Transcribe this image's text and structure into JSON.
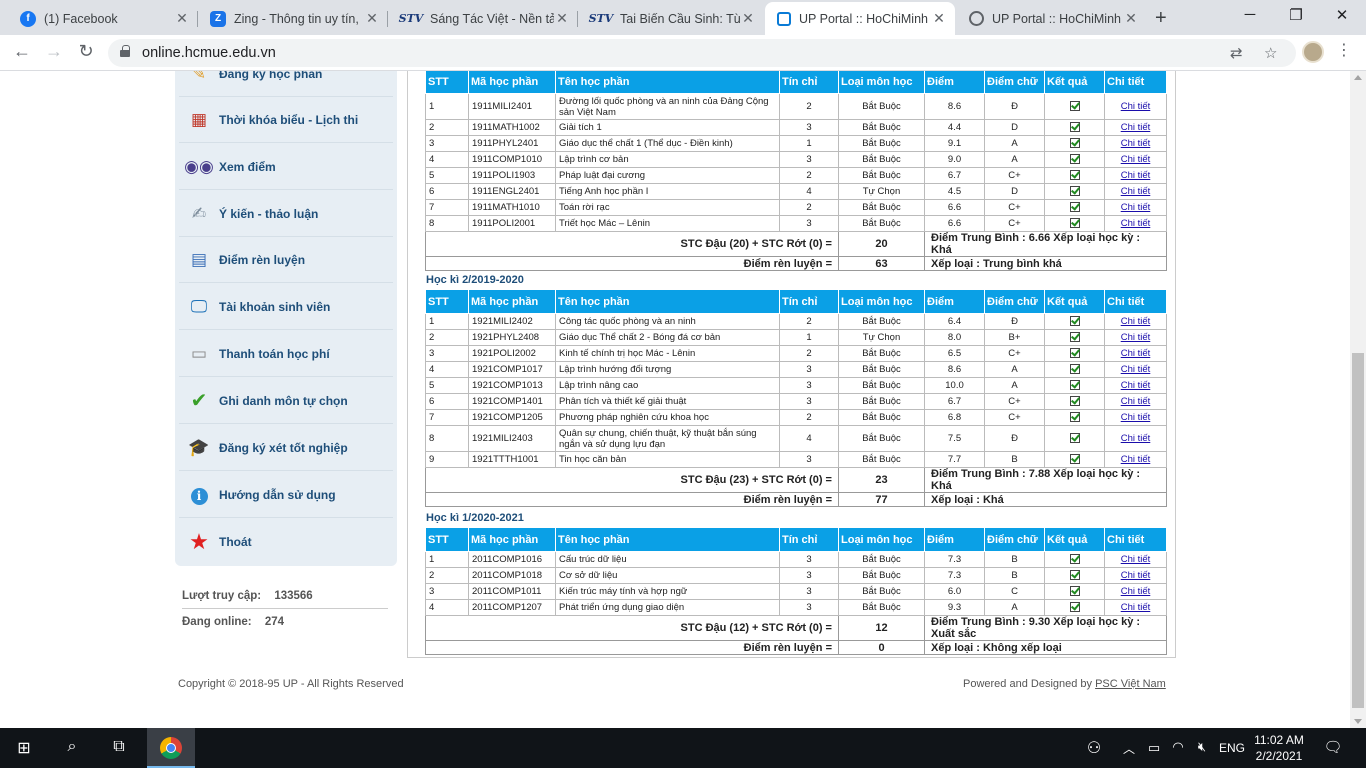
{
  "browser": {
    "tabs": [
      {
        "icon": "facebook-icon",
        "title": "(1) Facebook"
      },
      {
        "icon": "zing-icon",
        "title": "Zing - Thông tin uy tín,"
      },
      {
        "icon": "stv-icon",
        "title": "Sáng Tác Việt - Nền tản"
      },
      {
        "icon": "stv-icon",
        "title": "Tai Biến Cầu Sinh: Từ Đô"
      },
      {
        "icon": "up-portal-icon",
        "title": "UP Portal :: HoChiMinh"
      },
      {
        "icon": "globe-icon",
        "title": "UP Portal :: HoChiMinh"
      }
    ],
    "url": "online.hcmue.edu.vn"
  },
  "sidebar": {
    "items": [
      {
        "icon": "register-course-icon",
        "label": "Đăng ký học phần"
      },
      {
        "icon": "calendar-icon",
        "label": "Thời khóa biểu - Lịch thi"
      },
      {
        "icon": "binoculars-icon",
        "label": "Xem điểm"
      },
      {
        "icon": "feedback-icon",
        "label": "Ý kiến - thảo luận"
      },
      {
        "icon": "training-score-icon",
        "label": "Điểm rèn luyện"
      },
      {
        "icon": "monitor-icon",
        "label": "Tài khoản sinh viên"
      },
      {
        "icon": "payment-icon",
        "label": "Thanh toán học phí"
      },
      {
        "icon": "checkmark-icon",
        "label": "Ghi danh môn tự chọn"
      },
      {
        "icon": "graduation-cap-icon",
        "label": "Đăng ký xét tốt nghiệp"
      },
      {
        "icon": "info-icon",
        "label": "Hướng dẫn sử dụng"
      },
      {
        "icon": "star-icon",
        "label": "Thoát"
      }
    ],
    "visits_label": "Lượt truy cập:",
    "visits_value": "133566",
    "online_label": "Đang online:",
    "online_value": "274"
  },
  "table_headers": [
    "STT",
    "Mã học phần",
    "Tên học phần",
    "Tín chỉ",
    "Loại môn học",
    "Điểm",
    "Điểm chữ",
    "Kết quả",
    "Chi tiết"
  ],
  "detail_link": "Chi tiết",
  "semesters": [
    {
      "title": "",
      "rows": [
        [
          "1",
          "1911MILI2401",
          "Đường lối quốc phòng và an ninh của Đảng Cộng sản Việt Nam",
          "2",
          "Bắt Buộc",
          "8.6",
          "Đ"
        ],
        [
          "2",
          "1911MATH1002",
          "Giải tích 1",
          "3",
          "Bắt Buộc",
          "4.4",
          "D"
        ],
        [
          "3",
          "1911PHYL2401",
          "Giáo dục thể chất 1 (Thể dục - Điền kinh)",
          "1",
          "Bắt Buộc",
          "9.1",
          "A"
        ],
        [
          "4",
          "1911COMP1010",
          "Lập trình cơ bản",
          "3",
          "Bắt Buộc",
          "9.0",
          "A"
        ],
        [
          "5",
          "1911POLI1903",
          "Pháp luật đại cương",
          "2",
          "Bắt Buộc",
          "6.7",
          "C+"
        ],
        [
          "6",
          "1911ENGL2401",
          "Tiếng Anh học phần I",
          "4",
          "Tự Chọn",
          "4.5",
          "D"
        ],
        [
          "7",
          "1911MATH1010",
          "Toán rời rạc",
          "2",
          "Bắt Buộc",
          "6.6",
          "C+"
        ],
        [
          "8",
          "1911POLI2001",
          "Triết học Mác – Lênin",
          "3",
          "Bắt Buộc",
          "6.6",
          "C+"
        ]
      ],
      "summary1_label": "STC Đậu (20) + STC Rớt (0) =",
      "summary1_value": "20",
      "summary1_text": "Điểm Trung Bình : 6.66 Xếp loại học kỳ : Khá",
      "summary2_label": "Điểm rèn luyện =",
      "summary2_value": "63",
      "summary2_text": "Xếp loại : Trung bình khá"
    },
    {
      "title": "Học kì 2/2019-2020",
      "rows": [
        [
          "1",
          "1921MILI2402",
          "Công tác quốc phòng và an ninh",
          "2",
          "Bắt Buộc",
          "6.4",
          "Đ"
        ],
        [
          "2",
          "1921PHYL2408",
          "Giáo dục Thể chất 2 - Bóng đá cơ bản",
          "1",
          "Tự Chọn",
          "8.0",
          "B+"
        ],
        [
          "3",
          "1921POLI2002",
          "Kinh tế chính trị học Mác - Lênin",
          "2",
          "Bắt Buộc",
          "6.5",
          "C+"
        ],
        [
          "4",
          "1921COMP1017",
          "Lập trình hướng đối tượng",
          "3",
          "Bắt Buộc",
          "8.6",
          "A"
        ],
        [
          "5",
          "1921COMP1013",
          "Lập trình nâng cao",
          "3",
          "Bắt Buộc",
          "10.0",
          "A"
        ],
        [
          "6",
          "1921COMP1401",
          "Phân tích và thiết kế giải thuật",
          "3",
          "Bắt Buộc",
          "6.7",
          "C+"
        ],
        [
          "7",
          "1921COMP1205",
          "Phương pháp nghiên cứu khoa học",
          "2",
          "Bắt Buộc",
          "6.8",
          "C+"
        ],
        [
          "8",
          "1921MILI2403",
          "Quân sự chung, chiến thuật, kỹ thuật bắn súng ngắn và sử dụng lựu đạn",
          "4",
          "Bắt Buộc",
          "7.5",
          "Đ"
        ],
        [
          "9",
          "1921TTTH1001",
          "Tin học căn bản",
          "3",
          "Bắt Buộc",
          "7.7",
          "B"
        ]
      ],
      "summary1_label": "STC Đậu (23) + STC Rớt (0) =",
      "summary1_value": "23",
      "summary1_text": "Điểm Trung Bình : 7.88 Xếp loại học kỳ : Khá",
      "summary2_label": "Điểm rèn luyện =",
      "summary2_value": "77",
      "summary2_text": "Xếp loại : Khá"
    },
    {
      "title": "Học kì 1/2020-2021",
      "rows": [
        [
          "1",
          "2011COMP1016",
          "Cấu trúc dữ liệu",
          "3",
          "Bắt Buộc",
          "7.3",
          "B"
        ],
        [
          "2",
          "2011COMP1018",
          "Cơ sở dữ liệu",
          "3",
          "Bắt Buộc",
          "7.3",
          "B"
        ],
        [
          "3",
          "2011COMP1011",
          "Kiến trúc máy tính và hợp ngữ",
          "3",
          "Bắt Buộc",
          "6.0",
          "C"
        ],
        [
          "4",
          "2011COMP1207",
          "Phát triển ứng dụng giao diện",
          "3",
          "Bắt Buộc",
          "9.3",
          "A"
        ]
      ],
      "summary1_label": "STC Đậu (12) + STC Rớt (0) =",
      "summary1_value": "12",
      "summary1_text": "Điểm Trung Bình : 9.30 Xếp loại học kỳ : Xuất sắc",
      "summary2_label": "Điểm rèn luyện =",
      "summary2_value": "0",
      "summary2_text": "Xếp loại : Không xếp loại"
    }
  ],
  "footer": {
    "copyright": "Copyright © 2018-95 UP - All Rights Reserved",
    "powered_prefix": "Powered and Designed by",
    "powered_link": "PSC Việt Nam"
  },
  "taskbar": {
    "language": "ENG",
    "time": "11:02 AM",
    "date": "2/2/2021"
  }
}
